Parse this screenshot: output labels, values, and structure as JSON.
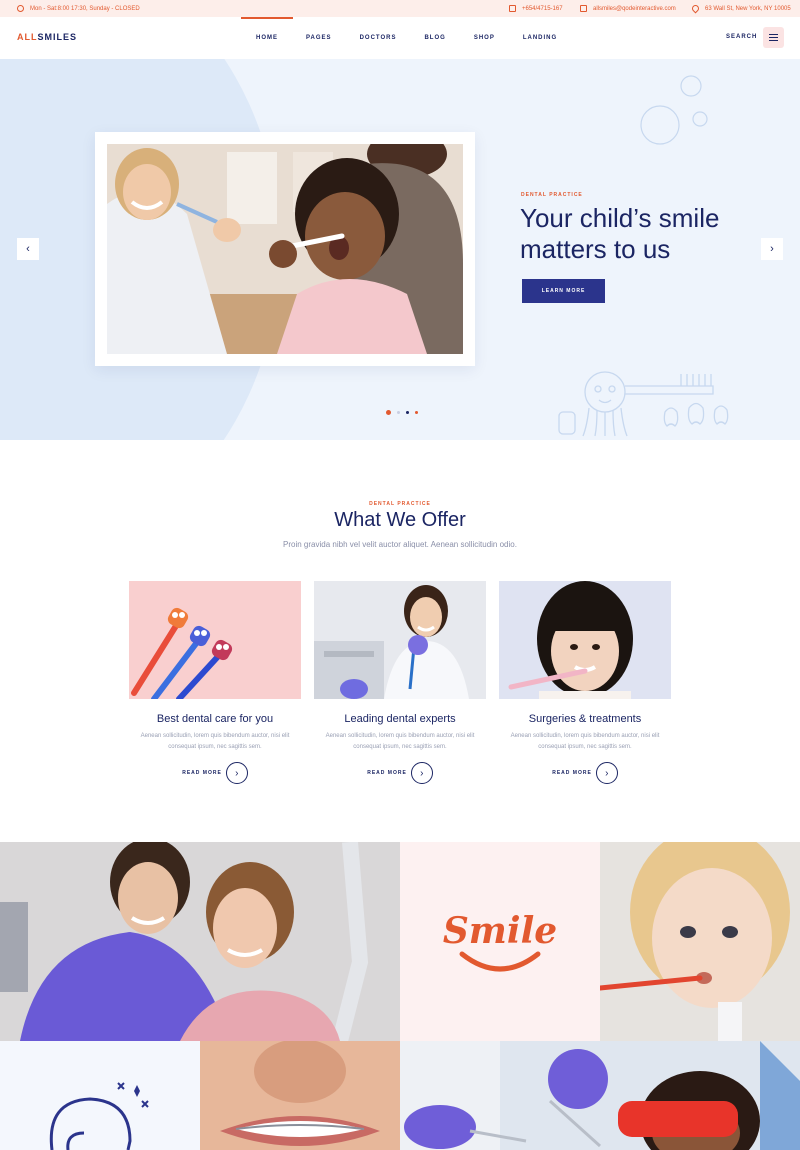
{
  "topbar": {
    "hours": "Mon - Sat:8:00 17:30, Sunday - CLOSED",
    "phone": "+654/4715-167",
    "email": "allsmiles@qodeinteractive.com",
    "address": "63 Wall St, New York, NY 10005"
  },
  "header": {
    "logo_all": "ALL",
    "logo_smiles": "SMILES",
    "nav": [
      "HOME",
      "PAGES",
      "DOCTORS",
      "BLOG",
      "SHOP",
      "LANDING"
    ],
    "active_nav": "HOME",
    "search": "SEARCH"
  },
  "hero": {
    "kicker": "DENTAL PRACTICE",
    "title": "Your child’s smile matters to us",
    "button": "LEARN MORE",
    "prev_icon": "‹",
    "next_icon": "›",
    "slides_total": 4,
    "slide_active": 1
  },
  "offer": {
    "kicker": "DENTAL PRACTICE",
    "title": "What We Offer",
    "subtitle": "Proin gravida nibh vel velit auctor aliquet. Aenean sollicitudin odio.",
    "cards": [
      {
        "title": "Best dental care for you",
        "text": "Aenean sollicitudin, lorem quis bibendum auctor, nisi elit consequat ipsum, nec sagittis sem.",
        "more": "READ MORE"
      },
      {
        "title": "Leading dental experts",
        "text": "Aenean sollicitudin, lorem quis bibendum auctor, nisi elit consequat ipsum, nec sagittis sem.",
        "more": "READ MORE"
      },
      {
        "title": "Surgeries & treatments",
        "text": "Aenean sollicitudin, lorem quis bibendum auctor, nisi elit consequat ipsum, nec sagittis sem.",
        "more": "READ MORE"
      }
    ]
  },
  "gallery": {
    "smile_logo": "Smile"
  },
  "colors": {
    "accent": "#e2592f",
    "navy": "#1b2563",
    "button": "#2b348c",
    "hero_bg": "#eef4fc",
    "topbar_bg": "#fdeeea"
  }
}
